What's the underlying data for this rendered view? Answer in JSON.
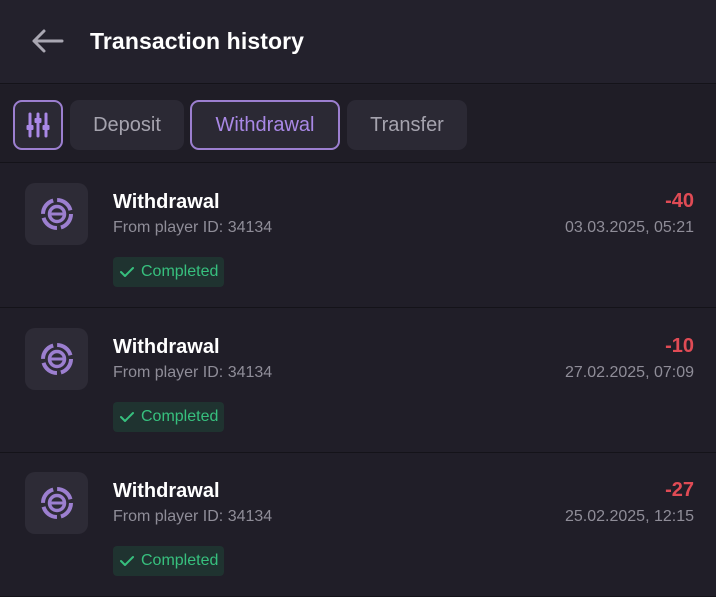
{
  "header": {
    "title": "Transaction history",
    "back_icon": "arrow-left-icon"
  },
  "filters": {
    "filter_icon": "sliders-icon",
    "tabs": [
      {
        "label": "Deposit",
        "active": false
      },
      {
        "label": "Withdrawal",
        "active": true
      },
      {
        "label": "Transfer",
        "active": false
      }
    ]
  },
  "transactions": [
    {
      "title": "Withdrawal",
      "subtitle": "From player ID: 34134",
      "status": "Completed",
      "amount": "-40",
      "date": "03.03.2025, 05:21"
    },
    {
      "title": "Withdrawal",
      "subtitle": "From player ID: 34134",
      "status": "Completed",
      "amount": "-10",
      "date": "27.02.2025, 07:09"
    },
    {
      "title": "Withdrawal",
      "subtitle": "From player ID: 34134",
      "status": "Completed",
      "amount": "-27",
      "date": "25.02.2025, 12:15"
    }
  ],
  "colors": {
    "accent": "#9c7fd0",
    "negative": "#e04b55",
    "success": "#37c07e",
    "background": "#201e28"
  }
}
